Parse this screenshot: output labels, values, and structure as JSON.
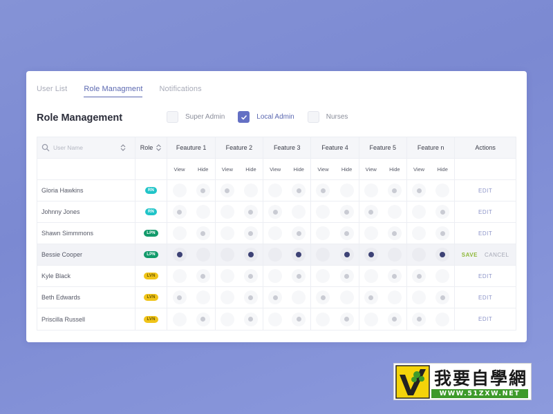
{
  "tabs": [
    {
      "label": "User List",
      "active": false
    },
    {
      "label": "Role Managment",
      "active": true
    },
    {
      "label": "Notifications",
      "active": false
    }
  ],
  "title": "Role Management",
  "role_filters": [
    {
      "label": "Super Admin",
      "checked": false
    },
    {
      "label": "Local Admin",
      "checked": true
    },
    {
      "label": "Nurses",
      "checked": false
    }
  ],
  "table": {
    "search_placeholder": "User Name",
    "role_header": "Role",
    "actions_header": "Actions",
    "features": [
      "Feauture 1",
      "Feature 2",
      "Feature 3",
      "Feature 4",
      "Feature 5",
      "Feature n"
    ],
    "sub_headers": {
      "view": "View",
      "hide": "Hide"
    },
    "rows": [
      {
        "name": "Gloria Hawkins",
        "role": "RN",
        "perms": [
          "hide",
          "view",
          "hide",
          "view",
          "hide",
          "view"
        ],
        "editing": false
      },
      {
        "name": "Johnny Jones",
        "role": "RN",
        "perms": [
          "view",
          "hide",
          "view",
          "hide",
          "view",
          "hide"
        ],
        "editing": false
      },
      {
        "name": "Shawn Simmmons",
        "role": "LPN",
        "perms": [
          "hide",
          "hide",
          "hide",
          "hide",
          "hide",
          "hide"
        ],
        "editing": false
      },
      {
        "name": "Bessie Cooper",
        "role": "LPN",
        "perms": [
          "view",
          "hide",
          "hide",
          "hide",
          "view",
          "hide"
        ],
        "editing": true
      },
      {
        "name": "Kyle Black",
        "role": "LVN",
        "perms": [
          "hide",
          "hide",
          "hide",
          "hide",
          "hide",
          "view"
        ],
        "editing": false
      },
      {
        "name": "Beth Edwards",
        "role": "LVN",
        "perms": [
          "view",
          "hide",
          "view",
          "view",
          "view",
          "hide"
        ],
        "editing": false
      },
      {
        "name": "Priscilla Russell",
        "role": "LVN",
        "perms": [
          "hide",
          "hide",
          "hide",
          "hide",
          "hide",
          "view"
        ],
        "editing": false
      }
    ],
    "edit_label": "EDIT",
    "save_label": "SAVE",
    "cancel_label": "CANCEL"
  },
  "watermark": {
    "title": "我要自學網",
    "url": "WWW.51ZXW.NET"
  },
  "colors": {
    "accent": "#5a67b0",
    "rn": "#20c4c8",
    "lpn": "#129a6b",
    "lvn": "#f0c419",
    "save": "#8fb83a"
  }
}
